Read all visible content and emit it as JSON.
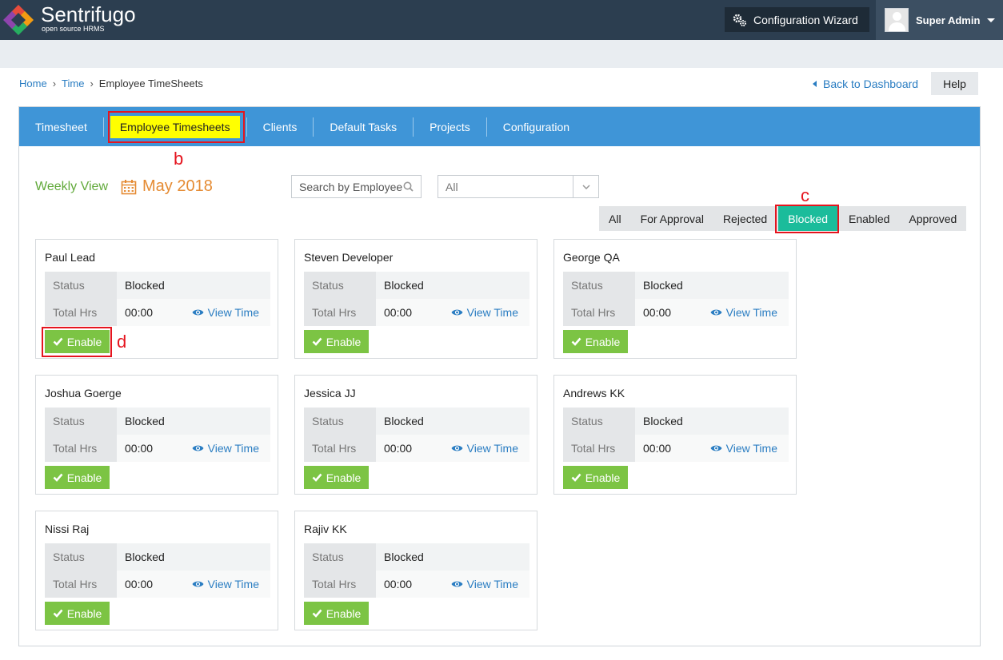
{
  "header": {
    "brand": "Sentrifugo",
    "brand_sub": "open source HRMS",
    "config_wizard": "Configuration Wizard",
    "user_name": "Super Admin"
  },
  "breadcrumb": {
    "home": "Home",
    "time": "Time",
    "current": "Employee TimeSheets"
  },
  "back_to_dashboard": "Back to Dashboard",
  "help": "Help",
  "tabs": [
    "Timesheet",
    "Employee Timesheets",
    "Clients",
    "Default Tasks",
    "Projects",
    "Configuration"
  ],
  "annotations": {
    "b": "b",
    "c": "c",
    "d": "d"
  },
  "view": {
    "weekly": "Weekly View",
    "month": "May 2018"
  },
  "search": {
    "placeholder": "Search by Employee"
  },
  "select": {
    "value": "All"
  },
  "filters": [
    "All",
    "For Approval",
    "Rejected",
    "Blocked",
    "Enabled",
    "Approved"
  ],
  "active_filter": "Blocked",
  "card_labels": {
    "status": "Status",
    "total_hrs": "Total Hrs",
    "view_time": "View Time",
    "enable": "Enable"
  },
  "employees": [
    {
      "name": "Paul Lead",
      "status": "Blocked",
      "hours": "00:00"
    },
    {
      "name": "Steven Developer",
      "status": "Blocked",
      "hours": "00:00"
    },
    {
      "name": "George QA",
      "status": "Blocked",
      "hours": "00:00"
    },
    {
      "name": "Joshua Goerge",
      "status": "Blocked",
      "hours": "00:00"
    },
    {
      "name": "Jessica JJ",
      "status": "Blocked",
      "hours": "00:00"
    },
    {
      "name": "Andrews KK",
      "status": "Blocked",
      "hours": "00:00"
    },
    {
      "name": "Nissi Raj",
      "status": "Blocked",
      "hours": "00:00"
    },
    {
      "name": "Rajiv KK",
      "status": "Blocked",
      "hours": "00:00"
    }
  ],
  "colors": {
    "header": "#2c3e50",
    "tabbar": "#3f95d7",
    "active_tab": "#ffff00",
    "active_filter": "#1bbc9b",
    "enable": "#7cc444",
    "annotation": "#e5141e"
  }
}
